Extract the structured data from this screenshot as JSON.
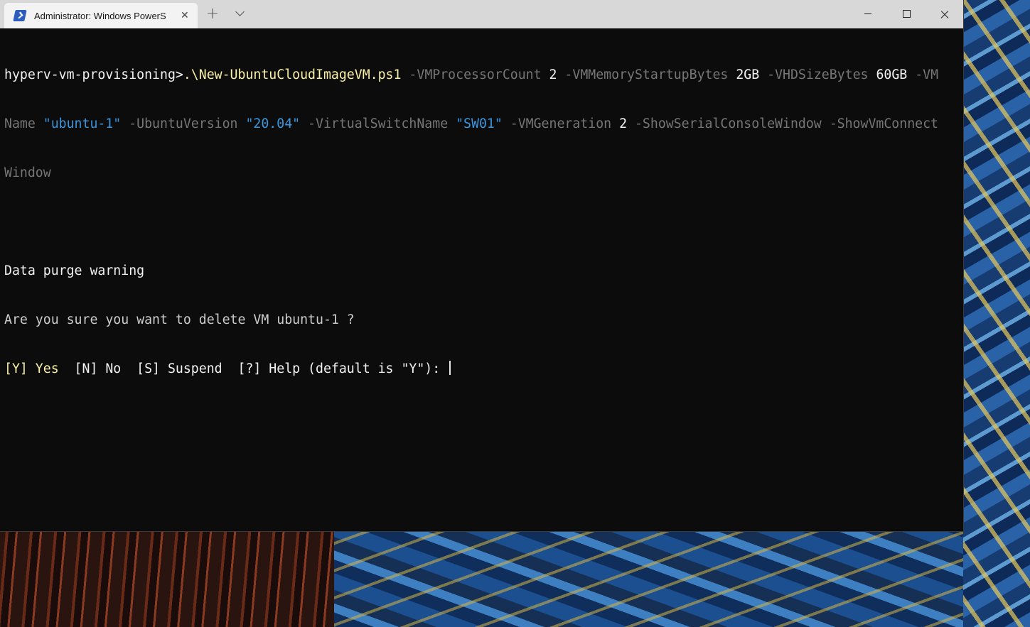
{
  "window": {
    "tab_title": "Administrator: Windows PowerS",
    "tab_close": "✕",
    "new_tab": "+"
  },
  "console": {
    "line1": {
      "prompt": "hyperv-vm-provisioning>",
      "script": ".\\New-UbuntuCloudImageVM.ps1",
      "p1": " -VMProcessorCount ",
      "v1": "2",
      "p2": " -VMMemoryStartupBytes ",
      "v2": "2GB",
      "p3": " -VHDSizeBytes ",
      "v3": "60GB",
      "p4": " -VM"
    },
    "line2": {
      "p4b": "Name ",
      "v4": "\"ubuntu-1\"",
      "p5": " -UbuntuVersion ",
      "v5": "\"20.04\"",
      "p6": " -VirtualSwitchName ",
      "v6": "\"SW01\"",
      "p7": " -VMGeneration ",
      "v7": "2",
      "p8": " -ShowSerialConsoleWindow -ShowVmConnect"
    },
    "line3": {
      "p8b": "Window"
    },
    "warning_title": "Data purge warning",
    "question": "Are you sure you want to delete VM ubuntu-1 ?",
    "choices": {
      "yes": "[Y] Yes",
      "rest": "  [N] No  [S] Suspend  [?] Help (default is \"Y\"): "
    }
  }
}
